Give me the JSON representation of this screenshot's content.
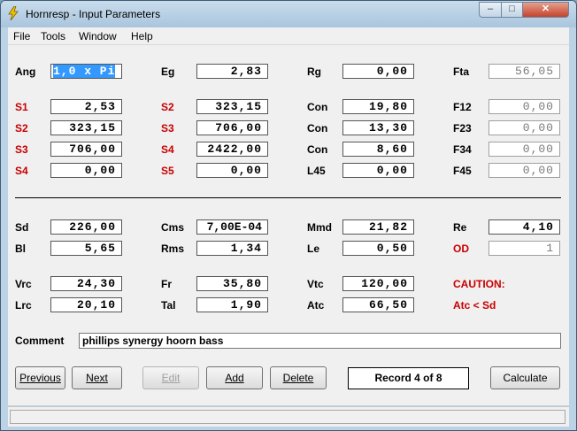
{
  "window": {
    "title": "Hornresp - Input Parameters",
    "min": "–",
    "max": "□",
    "close": "✕"
  },
  "menu": [
    "File",
    "Tools",
    "Window",
    "Help"
  ],
  "top": {
    "ang": {
      "label": "Ang",
      "value": "1,0 x Pi"
    },
    "eg": {
      "label": "Eg",
      "value": "2,83"
    },
    "rg": {
      "label": "Rg",
      "value": "0,00"
    },
    "fta": {
      "label": "Fta",
      "value": "56,05"
    }
  },
  "segments": [
    {
      "a_label": "S1",
      "a_value": "2,53",
      "b_label": "S2",
      "b_value": "323,15",
      "c_label": "Con",
      "c_value": "19,80",
      "d_label": "F12",
      "d_value": "0,00"
    },
    {
      "a_label": "S2",
      "a_value": "323,15",
      "b_label": "S3",
      "b_value": "706,00",
      "c_label": "Con",
      "c_value": "13,30",
      "d_label": "F23",
      "d_value": "0,00"
    },
    {
      "a_label": "S3",
      "a_value": "706,00",
      "b_label": "S4",
      "b_value": "2422,00",
      "c_label": "Con",
      "c_value": "8,60",
      "d_label": "F34",
      "d_value": "0,00"
    },
    {
      "a_label": "S4",
      "a_value": "0,00",
      "b_label": "S5",
      "b_value": "0,00",
      "c_label": "L45",
      "c_value": "0,00",
      "d_label": "F45",
      "d_value": "0,00"
    }
  ],
  "driver": {
    "sd": {
      "label": "Sd",
      "value": "226,00"
    },
    "cms": {
      "label": "Cms",
      "value": "7,00E-04"
    },
    "mmd": {
      "label": "Mmd",
      "value": "21,82"
    },
    "re": {
      "label": "Re",
      "value": "4,10"
    },
    "bl": {
      "label": "Bl",
      "value": "5,65"
    },
    "rms": {
      "label": "Rms",
      "value": "1,34"
    },
    "le": {
      "label": "Le",
      "value": "0,50"
    },
    "od": {
      "label": "OD",
      "value": "1"
    }
  },
  "chamber": {
    "vrc": {
      "label": "Vrc",
      "value": "24,30"
    },
    "fr": {
      "label": "Fr",
      "value": "35,80"
    },
    "vtc": {
      "label": "Vtc",
      "value": "120,00"
    },
    "lrc": {
      "label": "Lrc",
      "value": "20,10"
    },
    "tal": {
      "label": "Tal",
      "value": "1,90"
    },
    "atc": {
      "label": "Atc",
      "value": "66,50"
    },
    "caution": "CAUTION:",
    "warning": "Atc < Sd"
  },
  "comment": {
    "label": "Comment",
    "value": "phillips synergy hoorn bass"
  },
  "buttons": {
    "previous": "Previous",
    "next": "Next",
    "edit": "Edit",
    "add": "Add",
    "delete": "Delete",
    "calculate": "Calculate"
  },
  "record": "Record 4 of 8",
  "colors": {
    "red_label": "#c80000",
    "selection": "#3399ff"
  }
}
